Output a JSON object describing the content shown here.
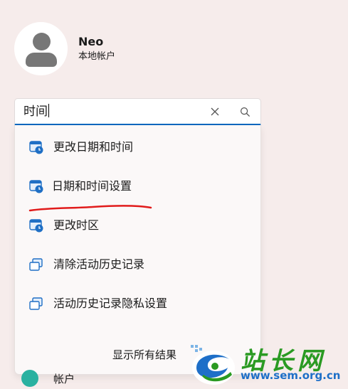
{
  "profile": {
    "name": "Neo",
    "account_type": "本地帐户"
  },
  "search": {
    "value": "时间"
  },
  "suggestions": [
    {
      "label": "更改日期和时间",
      "icon": "calendar-clock-icon"
    },
    {
      "label": "日期和时间设置",
      "icon": "calendar-clock-icon"
    },
    {
      "label": "更改时区",
      "icon": "calendar-clock-icon"
    },
    {
      "label": "清除活动历史记录",
      "icon": "activity-history-icon"
    },
    {
      "label": "活动历史记录隐私设置",
      "icon": "activity-history-icon"
    }
  ],
  "show_all": "显示所有结果",
  "bottom_nav": {
    "label": "帐户"
  },
  "watermark": {
    "brand": "站长网",
    "url": "www.sem.org.cn"
  },
  "colors": {
    "accent": "#0067c0",
    "annotation": "#e11b1b",
    "watermark_green": "#2a9a22",
    "watermark_blue": "#1e6fc8"
  }
}
